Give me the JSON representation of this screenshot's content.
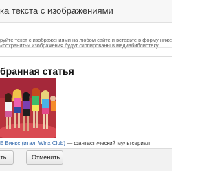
{
  "dialog": {
    "title": "ка текста с изображениями"
  },
  "notice": {
    "line1": "руйте текст с изображениями на любом сайте и вставьте в форму ниже. После нажатия",
    "line2": "«сохранить» изображения будут скопированы в медиабиблиотеку"
  },
  "article": {
    "heading": "бранная статья",
    "caption_link": "Е Винкс (итал. Winx Club)",
    "caption_rest": " — фантастический мультсериал"
  },
  "buttons": {
    "insert_label": "ть",
    "cancel_label": "Отменить"
  }
}
